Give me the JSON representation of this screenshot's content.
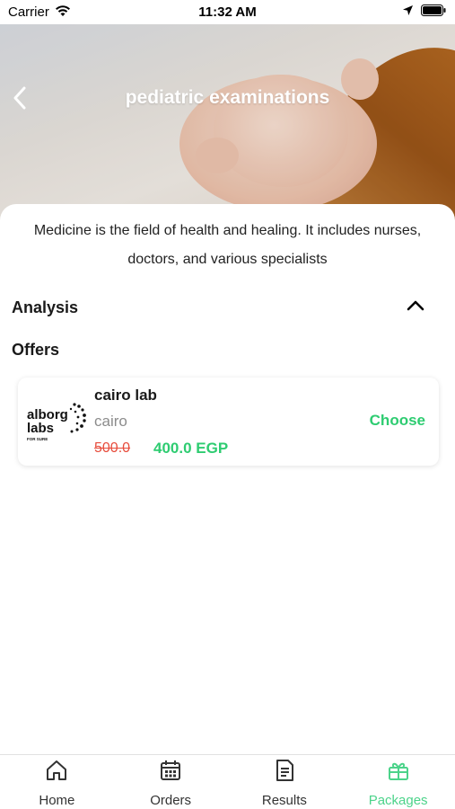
{
  "status_bar": {
    "carrier": "Carrier",
    "time": "11:32 AM"
  },
  "header": {
    "title": "pediatric examinations"
  },
  "description": "Medicine is the field of health and healing. It includes nurses, doctors, and various specialists",
  "sections": {
    "analysis_label": "Analysis",
    "offers_label": "Offers"
  },
  "offer": {
    "lab_name": "cairo lab",
    "city": "cairo",
    "old_price": "500.0",
    "new_price": "400.0 EGP",
    "choose_label": "Choose",
    "logo_text_1": "alborg",
    "logo_text_2": "labs",
    "logo_text_3": "FOR SURE"
  },
  "tab_bar": {
    "items": [
      {
        "label": "Home",
        "icon": "home-icon"
      },
      {
        "label": "Orders",
        "icon": "calendar-icon"
      },
      {
        "label": "Results",
        "icon": "document-icon"
      },
      {
        "label": "Packages",
        "icon": "gift-icon"
      }
    ],
    "active_index": 3
  },
  "colors": {
    "accent_green": "#2ecc71",
    "tab_active": "#4cd38a",
    "old_price_red": "#e74c3c"
  }
}
